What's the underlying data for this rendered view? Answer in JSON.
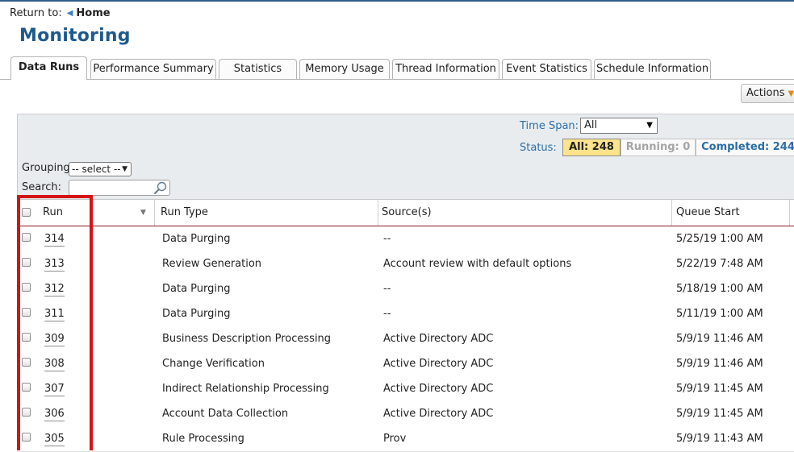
{
  "nav": {
    "return_label": "Return to:",
    "home_label": "Home"
  },
  "page": {
    "title": "Monitoring"
  },
  "tabs": [
    {
      "label": "Data Runs"
    },
    {
      "label": "Performance Summary"
    },
    {
      "label": "Statistics"
    },
    {
      "label": "Memory Usage"
    },
    {
      "label": "Thread Information"
    },
    {
      "label": "Event Statistics"
    },
    {
      "label": "Schedule Information"
    }
  ],
  "toolbar": {
    "actions_label": "Actions"
  },
  "filters": {
    "time_span_label": "Time Span:",
    "time_span_value": "All",
    "status_label": "Status:",
    "status_all": "All: 248",
    "status_running": "Running: 0",
    "status_completed": "Completed: 244",
    "grouping_label": "Grouping:",
    "grouping_value": "-- select --",
    "search_label": "Search:",
    "search_value": ""
  },
  "table": {
    "columns": [
      "Run",
      "Run Type",
      "Source(s)",
      "Queue Start"
    ],
    "rows": [
      {
        "run": "314",
        "type": "Data Purging",
        "sources": "--",
        "queue_start": "5/25/19 1:00 AM"
      },
      {
        "run": "313",
        "type": "Review Generation",
        "sources": "Account review with default options",
        "queue_start": "5/22/19 7:48 AM"
      },
      {
        "run": "312",
        "type": "Data Purging",
        "sources": "--",
        "queue_start": "5/18/19 1:00 AM"
      },
      {
        "run": "311",
        "type": "Data Purging",
        "sources": "--",
        "queue_start": "5/11/19 1:00 AM"
      },
      {
        "run": "309",
        "type": "Business Description Processing",
        "sources": "Active Directory ADC",
        "queue_start": "5/9/19 11:46 AM"
      },
      {
        "run": "308",
        "type": "Change Verification",
        "sources": "Active Directory ADC",
        "queue_start": "5/9/19 11:46 AM"
      },
      {
        "run": "307",
        "type": "Indirect Relationship Processing",
        "sources": "Active Directory ADC",
        "queue_start": "5/9/19 11:45 AM"
      },
      {
        "run": "306",
        "type": "Account Data Collection",
        "sources": "Active Directory ADC",
        "queue_start": "5/9/19 11:45 AM"
      },
      {
        "run": "305",
        "type": "Rule Processing",
        "sources": "Prov",
        "queue_start": "5/9/19 11:43 AM"
      }
    ]
  },
  "colors": {
    "title": "#1e5a8c",
    "link_blue": "#2b6ea6",
    "status_all_bg": "#fde38a",
    "highlight": "#d41414",
    "header_underline": "#8a1b1b"
  }
}
